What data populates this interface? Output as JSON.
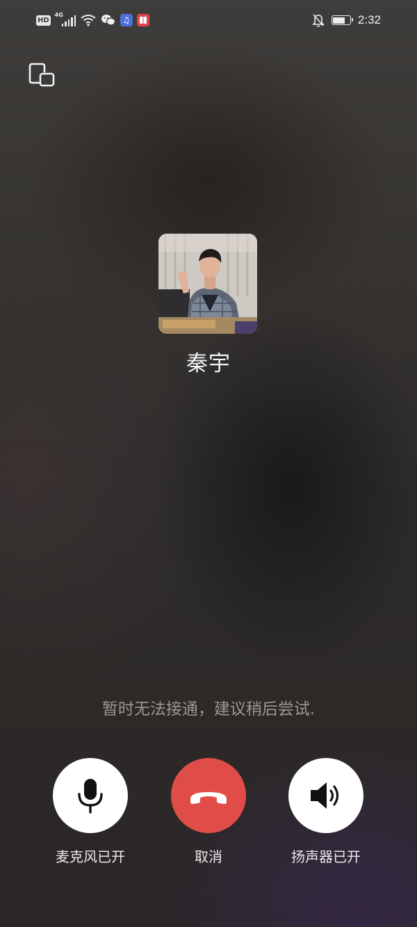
{
  "status_bar": {
    "hd_label": "HD",
    "network_label": "4G",
    "time": "2:32",
    "battery_level": 0.65,
    "icons": [
      "hd-badge-icon",
      "signal-icon",
      "wifi-icon",
      "wechat-icon",
      "music-app-icon",
      "book-app-icon",
      "bell-off-icon",
      "battery-icon"
    ]
  },
  "call": {
    "contact_name": "秦宇",
    "status_message": "暂时无法接通，建议稍后尝试."
  },
  "controls": {
    "mic_label": "麦克风已开",
    "cancel_label": "取消",
    "speaker_label": "扬声器已开"
  },
  "colors": {
    "cancel_button": "#e04d49",
    "control_button": "#ffffff",
    "status_text": "#9a9795"
  }
}
